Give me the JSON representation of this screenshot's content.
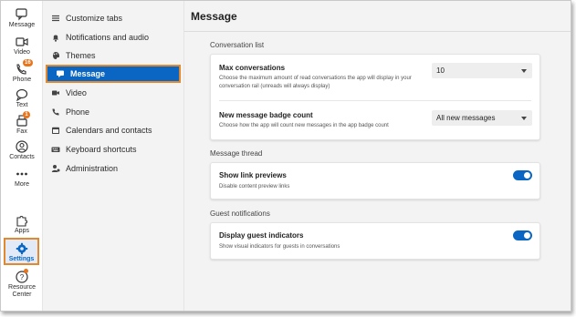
{
  "rail": {
    "items": [
      {
        "label": "Message",
        "icon": "chat-bubble-icon"
      },
      {
        "label": "Video",
        "icon": "video-camera-icon"
      },
      {
        "label": "Phone",
        "icon": "phone-icon",
        "badge": "16"
      },
      {
        "label": "Text",
        "icon": "text-bubble-icon"
      },
      {
        "label": "Fax",
        "icon": "fax-icon",
        "badge": "1"
      },
      {
        "label": "Contacts",
        "icon": "contacts-icon"
      },
      {
        "label": "More",
        "icon": "more-dots-icon"
      },
      {
        "label": "Apps",
        "icon": "puzzle-icon"
      },
      {
        "label": "Settings",
        "icon": "gear-icon"
      },
      {
        "label_line1": "Resource",
        "label_line2": "Center",
        "icon": "help-icon"
      }
    ]
  },
  "nav": {
    "items": [
      {
        "label": "Customize tabs",
        "icon": "lines-icon"
      },
      {
        "label": "Notifications and audio",
        "icon": "bell-icon"
      },
      {
        "label": "Themes",
        "icon": "palette-icon"
      },
      {
        "label": "Message",
        "icon": "message-icon"
      },
      {
        "label": "Video",
        "icon": "video-icon"
      },
      {
        "label": "Phone",
        "icon": "phone-icon"
      },
      {
        "label": "Calendars and contacts",
        "icon": "calendar-icon"
      },
      {
        "label": "Keyboard shortcuts",
        "icon": "keyboard-icon"
      },
      {
        "label": "Administration",
        "icon": "admin-icon"
      }
    ],
    "active": "Message"
  },
  "main": {
    "title": "Message",
    "conversation_list": {
      "label": "Conversation list",
      "max_conversations": {
        "title": "Max conversations",
        "desc": "Choose the maximum amount of read conversations the app will display in your conversation rail (unreads will always display)",
        "value": "10"
      },
      "badge_count": {
        "title": "New message badge count",
        "desc": "Choose how the app will count new messages in the app badge count",
        "value": "All new messages"
      }
    },
    "message_thread": {
      "label": "Message thread",
      "link_previews": {
        "title": "Show link previews",
        "desc": "Disable content preview links",
        "enabled": true
      }
    },
    "guest_notifications": {
      "label": "Guest notifications",
      "guest_indicators": {
        "title": "Display guest indicators",
        "desc": "Show visual indicators for guests in conversations",
        "enabled": true
      }
    }
  },
  "colors": {
    "accent": "#0a66c2",
    "highlight": "#e0892f",
    "badge": "#e8741b"
  }
}
